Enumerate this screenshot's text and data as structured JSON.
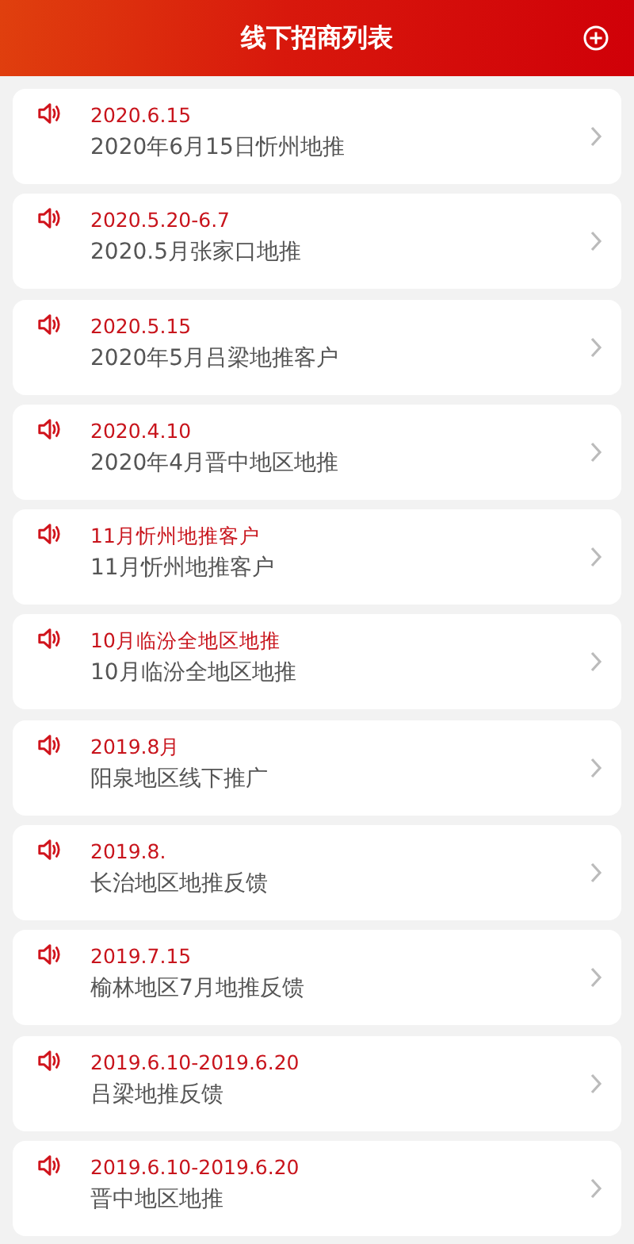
{
  "header": {
    "title": "线下招商列表"
  },
  "items": [
    {
      "date": "2020.6.15",
      "title": "2020年6月15日忻州地推"
    },
    {
      "date": "2020.5.20-6.7",
      "title": "2020.5月张家口地推"
    },
    {
      "date": "2020.5.15",
      "title": "2020年5月吕梁地推客户"
    },
    {
      "date": "2020.4.10",
      "title": "2020年4月晋中地区地推"
    },
    {
      "date": "11月忻州地推客户",
      "title": "11月忻州地推客户"
    },
    {
      "date": "10月临汾全地区地推",
      "title": "10月临汾全地区地推"
    },
    {
      "date": "2019.8月",
      "title": "阳泉地区线下推广"
    },
    {
      "date": "2019.8.",
      "title": "长治地区地推反馈"
    },
    {
      "date": "2019.7.15",
      "title": "榆林地区7月地推反馈"
    },
    {
      "date": "2019.6.10-2019.6.20",
      "title": "吕梁地推反馈"
    },
    {
      "date": "2019.6.10-2019.6.20",
      "title": "晋中地区地推"
    }
  ]
}
